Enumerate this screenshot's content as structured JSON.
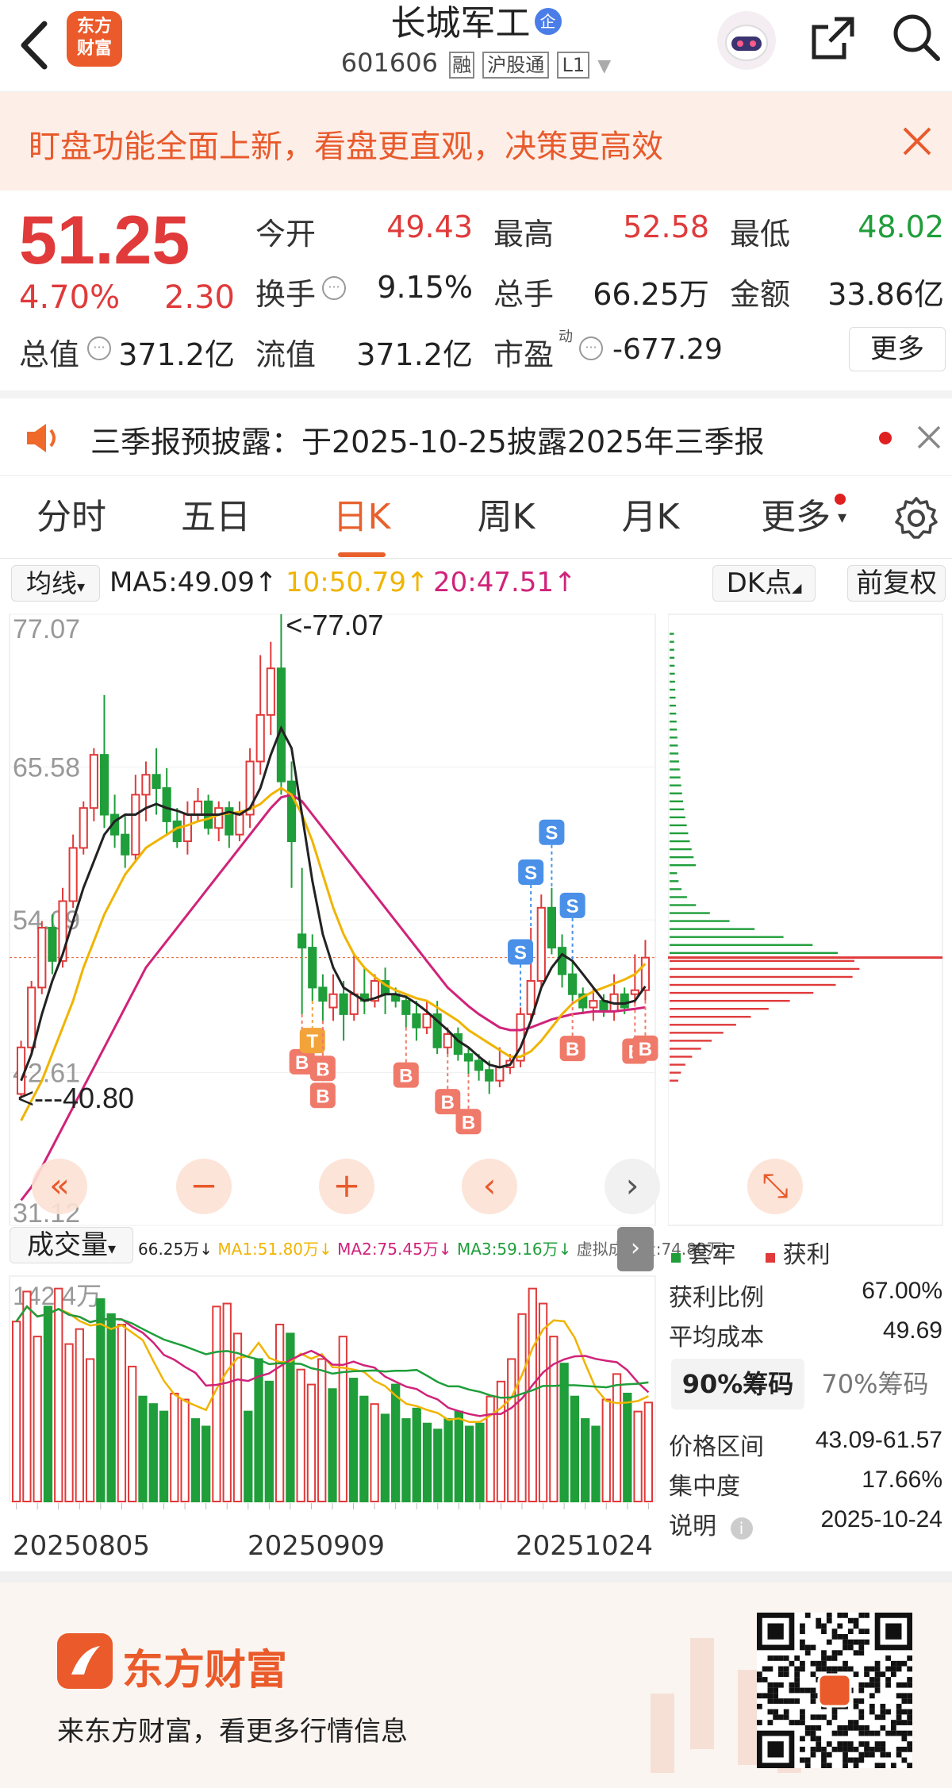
{
  "header": {
    "stock_name": "长城军工",
    "badge": "企",
    "code": "601606",
    "tags": [
      "融",
      "沪股通",
      "L1"
    ],
    "logo_text": "东方\n财富"
  },
  "banner": {
    "text": "盯盘功能全面上新，看盘更直观，决策更高效"
  },
  "quote": {
    "price": "51.25",
    "change_pct": "4.70%",
    "change": "2.30",
    "open_label": "今开",
    "open": "49.43",
    "high_label": "最高",
    "high": "52.58",
    "low_label": "最低",
    "low": "48.02",
    "turnover_label": "换手",
    "turnover": "9.15%",
    "volume_label": "总手",
    "volume": "66.25万",
    "amount_label": "金额",
    "amount": "33.86亿",
    "mktcap_label": "总值",
    "mktcap": "371.2亿",
    "float_label": "流值",
    "float": "371.2亿",
    "pe_label": "市盈",
    "pe_sup": "动",
    "pe": "-677.29",
    "more_label": "更多"
  },
  "notice": {
    "text": "三季报预披露：于2025-10-25披露2025年三季报"
  },
  "tabs": [
    "分时",
    "五日",
    "日K",
    "周K",
    "月K",
    "更多"
  ],
  "active_tab": "日K",
  "ma_bar": {
    "selector": "均线",
    "ma5": "MA5:49.09↑",
    "ma10": "10:50.79↑",
    "ma20": "20:47.51↑",
    "dk": "DK点",
    "adjust": "前复权"
  },
  "colors": {
    "up": "#e03a3a",
    "down": "#1f9e3a",
    "accent": "#e8602c",
    "ma5": "#222222",
    "ma10": "#f0b400",
    "ma20": "#d0237a"
  },
  "chart_data": {
    "type": "candlestick",
    "ylim": [
      31.12,
      77.07
    ],
    "y_ticks": [
      "77.07",
      "65.58",
      "54.09",
      "42.61",
      "31.12"
    ],
    "annotations": [
      "<-77.07",
      "<---40.80"
    ],
    "x_labels": [
      "20250805",
      "20250909",
      "20251024"
    ],
    "candles": [
      [
        41.0,
        44.5,
        40.8,
        45.0
      ],
      [
        44.5,
        49.0,
        44.0,
        49.5
      ],
      [
        49.0,
        53.5,
        48.5,
        54.0
      ],
      [
        53.5,
        51.0,
        50.0,
        54.5
      ],
      [
        51.0,
        55.5,
        50.5,
        56.5
      ],
      [
        55.5,
        59.5,
        55.0,
        60.5
      ],
      [
        59.5,
        62.5,
        59.0,
        63.0
      ],
      [
        62.5,
        66.5,
        61.5,
        67.0
      ],
      [
        66.5,
        62.0,
        61.0,
        71.0
      ],
      [
        62.0,
        60.5,
        59.5,
        63.5
      ],
      [
        60.5,
        59.0,
        58.0,
        62.0
      ],
      [
        59.0,
        63.5,
        58.5,
        65.0
      ],
      [
        63.5,
        65.0,
        61.5,
        66.0
      ],
      [
        65.0,
        64.0,
        62.0,
        67.0
      ],
      [
        64.0,
        61.5,
        60.5,
        65.5
      ],
      [
        61.5,
        60.0,
        59.5,
        62.5
      ],
      [
        60.0,
        62.0,
        59.0,
        63.0
      ],
      [
        62.0,
        63.0,
        61.5,
        64.0
      ],
      [
        63.0,
        61.0,
        60.5,
        63.5
      ],
      [
        61.0,
        62.5,
        60.0,
        63.0
      ],
      [
        62.5,
        60.5,
        59.5,
        63.0
      ],
      [
        60.5,
        62.0,
        60.0,
        63.0
      ],
      [
        62.0,
        66.0,
        61.0,
        67.0
      ],
      [
        66.0,
        69.5,
        65.0,
        74.0
      ],
      [
        69.5,
        73.0,
        68.0,
        75.0
      ],
      [
        73.0,
        64.5,
        63.5,
        77.07
      ],
      [
        64.5,
        60.0,
        56.5,
        66.0
      ],
      [
        53.0,
        52.0,
        47.0,
        58.0
      ],
      [
        52.0,
        49.0,
        48.0,
        53.0
      ],
      [
        49.0,
        48.0,
        46.5,
        50.0
      ],
      [
        47.5,
        48.5,
        46.5,
        50.0
      ],
      [
        48.5,
        47.0,
        45.0,
        49.5
      ],
      [
        47.0,
        48.5,
        46.5,
        51.5
      ],
      [
        48.5,
        48.0,
        47.0,
        50.5
      ],
      [
        48.0,
        49.5,
        47.5,
        50.0
      ],
      [
        49.5,
        48.5,
        47.0,
        50.5
      ],
      [
        48.5,
        48.0,
        47.5,
        49.0
      ],
      [
        48.0,
        47.0,
        46.0,
        48.5
      ],
      [
        47.0,
        46.0,
        45.0,
        48.0
      ],
      [
        46.0,
        47.0,
        45.5,
        48.0
      ],
      [
        47.0,
        44.5,
        44.0,
        48.0
      ],
      [
        44.5,
        45.5,
        44.0,
        46.0
      ],
      [
        45.5,
        44.0,
        43.5,
        46.0
      ],
      [
        44.0,
        43.5,
        42.5,
        44.5
      ],
      [
        43.5,
        42.8,
        42.0,
        44.0
      ],
      [
        42.8,
        42.0,
        41.0,
        43.5
      ],
      [
        42.0,
        43.0,
        41.5,
        44.5
      ],
      [
        43.0,
        43.5,
        42.5,
        44.0
      ],
      [
        43.5,
        47.0,
        43.0,
        47.5
      ],
      [
        47.0,
        49.5,
        46.5,
        53.5
      ],
      [
        49.5,
        55.0,
        49.0,
        56.0
      ],
      [
        55.0,
        52.0,
        51.5,
        56.5
      ],
      [
        52.0,
        50.0,
        49.0,
        53.0
      ],
      [
        50.0,
        48.5,
        48.0,
        51.0
      ],
      [
        48.5,
        47.5,
        47.0,
        49.0
      ],
      [
        47.5,
        48.0,
        46.5,
        49.0
      ],
      [
        48.0,
        47.2,
        46.8,
        48.5
      ],
      [
        47.2,
        48.5,
        46.5,
        50.0
      ],
      [
        48.5,
        47.5,
        47.0,
        49.0
      ],
      [
        48.5,
        48.8,
        47.8,
        51.5
      ],
      [
        48.8,
        51.25,
        48.02,
        52.58
      ]
    ],
    "ma5": [
      42.0,
      44.0,
      47.0,
      49.5,
      51.5,
      54.0,
      56.5,
      58.5,
      60.5,
      61.5,
      62.0,
      62.0,
      62.5,
      62.8,
      62.5,
      62.3,
      62.0,
      62.0,
      62.0,
      62.0,
      62.2,
      62.0,
      62.5,
      64.0,
      66.5,
      68.5,
      67.0,
      62.0,
      57.0,
      53.0,
      50.5,
      49.0,
      48.5,
      48.0,
      48.2,
      48.5,
      48.5,
      48.3,
      47.8,
      47.2,
      46.5,
      45.8,
      45.0,
      44.5,
      43.8,
      43.2,
      43.0,
      43.2,
      44.5,
      46.5,
      49.0,
      50.5,
      51.5,
      51.0,
      50.0,
      49.0,
      48.0,
      47.8,
      47.8,
      48.0,
      49.09
    ],
    "ma10": [
      39.0,
      40.5,
      42.0,
      44.0,
      46.0,
      48.0,
      50.5,
      52.5,
      54.5,
      56.0,
      57.5,
      58.5,
      59.5,
      60.0,
      60.5,
      61.0,
      61.2,
      61.5,
      61.7,
      62.0,
      62.1,
      62.2,
      62.4,
      62.8,
      63.5,
      64.0,
      63.5,
      62.0,
      60.0,
      57.5,
      55.0,
      53.0,
      51.5,
      50.5,
      49.8,
      49.2,
      48.8,
      48.5,
      48.2,
      48.0,
      47.5,
      47.0,
      46.5,
      45.8,
      45.3,
      44.8,
      44.3,
      43.8,
      43.8,
      44.2,
      45.0,
      46.0,
      47.0,
      47.8,
      48.3,
      48.7,
      49.0,
      49.3,
      49.6,
      50.0,
      50.79
    ],
    "ma20": [
      33.0,
      34.0,
      35.5,
      37.0,
      38.5,
      40.0,
      41.5,
      43.0,
      44.5,
      46.0,
      47.5,
      49.0,
      50.5,
      51.5,
      52.5,
      53.5,
      54.5,
      55.5,
      56.5,
      57.5,
      58.5,
      59.5,
      60.5,
      61.5,
      62.5,
      63.3,
      63.5,
      63.0,
      62.0,
      61.0,
      60.0,
      59.0,
      58.0,
      57.0,
      56.0,
      55.0,
      54.0,
      53.0,
      52.0,
      51.0,
      50.0,
      49.0,
      48.3,
      47.6,
      47.0,
      46.5,
      46.0,
      45.8,
      45.8,
      46.0,
      46.3,
      46.6,
      46.8,
      47.0,
      47.1,
      47.2,
      47.2,
      47.2,
      47.3,
      47.4,
      47.51
    ],
    "signals": [
      {
        "i": 27,
        "type": "B"
      },
      {
        "i": 29,
        "type": "B"
      },
      {
        "i": 28,
        "type": "T"
      },
      {
        "i": 29,
        "type": "B"
      },
      {
        "i": 37,
        "type": "B"
      },
      {
        "i": 41,
        "type": "B"
      },
      {
        "i": 43,
        "type": "B"
      },
      {
        "i": 48,
        "type": "S"
      },
      {
        "i": 49,
        "type": "S"
      },
      {
        "i": 51,
        "type": "S"
      },
      {
        "i": 53,
        "type": "S"
      },
      {
        "i": 53,
        "type": "B"
      },
      {
        "i": 59,
        "type": "B"
      },
      {
        "i": 60,
        "type": "B"
      }
    ],
    "controls": [
      "«",
      "−",
      "+",
      "‹",
      "›"
    ]
  },
  "volume": {
    "selector": "成交量",
    "v": "66.25万↓",
    "ma1": "MA1:51.80万↓",
    "ma2": "MA2:75.45万↓",
    "ma3": "MA3:59.16万↓",
    "virtual": "虚拟成交量:74.80万",
    "max_label": "142.4万",
    "bars": [
      120,
      140,
      110,
      130,
      142,
      105,
      115,
      95,
      135,
      125,
      118,
      90,
      70,
      65,
      60,
      72,
      68,
      55,
      50,
      130,
      132,
      112,
      60,
      95,
      80,
      118,
      112,
      88,
      78,
      95,
      75,
      110,
      82,
      70,
      65,
      58,
      78,
      55,
      62,
      52,
      48,
      55,
      60,
      50,
      52,
      70,
      80,
      95,
      125,
      142,
      132,
      110,
      92,
      70,
      55,
      50,
      68,
      85,
      72,
      60,
      66
    ],
    "bar_up": [
      1,
      1,
      1,
      0,
      1,
      1,
      1,
      1,
      0,
      0,
      1,
      1,
      0,
      0,
      0,
      1,
      1,
      0,
      0,
      1,
      1,
      1,
      0,
      0,
      0,
      1,
      0,
      1,
      1,
      1,
      0,
      1,
      0,
      0,
      1,
      0,
      0,
      0,
      0,
      0,
      0,
      0,
      0,
      0,
      0,
      1,
      1,
      1,
      1,
      1,
      1,
      1,
      0,
      0,
      0,
      0,
      1,
      1,
      0,
      1,
      1
    ],
    "ma_lines_note": ""
  },
  "chip": {
    "legend_loss": "套牢",
    "legend_gain": "获利",
    "rows": [
      {
        "label": "获利比例",
        "value": "67.00%"
      },
      {
        "label": "平均成本",
        "value": "49.69"
      }
    ],
    "tab_90": "90%筹码",
    "tab_70": "70%筹码",
    "rows2": [
      {
        "label": "价格区间",
        "value": "43.09-61.57"
      },
      {
        "label": "集中度",
        "value": "17.66%"
      },
      {
        "label": "说明",
        "value": "2025-10-24"
      }
    ]
  },
  "footer": {
    "brand": "东方财富",
    "slogan": "来东方财富，看更多行情信息"
  }
}
